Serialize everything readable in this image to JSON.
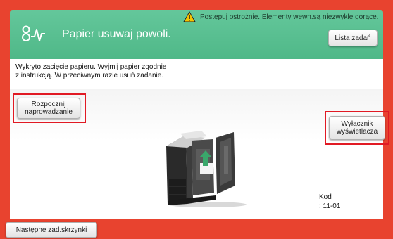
{
  "header": {
    "warning_text": "Postępuj ostrożnie. Elementy wewn.są niezwykle gorące.",
    "title": "Papier usuwaj powoli.",
    "job_list_label": "Lista zadań"
  },
  "message": {
    "line1": "Wykryto zacięcie papieru. Wyjmij papier zgodnie",
    "line2": "z instrukcją. W przeciwnym razie usuń zadanie."
  },
  "buttons": {
    "start_guide_line1": "Rozpocznij",
    "start_guide_line2": "naprowadzanie",
    "display_switch_line1": "Wyłącznik",
    "display_switch_line2": "wyświetlacza",
    "next_job_label": "Następne zad.skrzynki"
  },
  "code": {
    "label": "Kod",
    "value": ": 11-01"
  },
  "colors": {
    "frame": "#e8432f",
    "header": "#4fb888",
    "highlight": "#e11a24",
    "arrow": "#3aa86b"
  },
  "icons": {
    "warning": "warning-triangle-icon",
    "jam": "paper-jam-icon"
  }
}
